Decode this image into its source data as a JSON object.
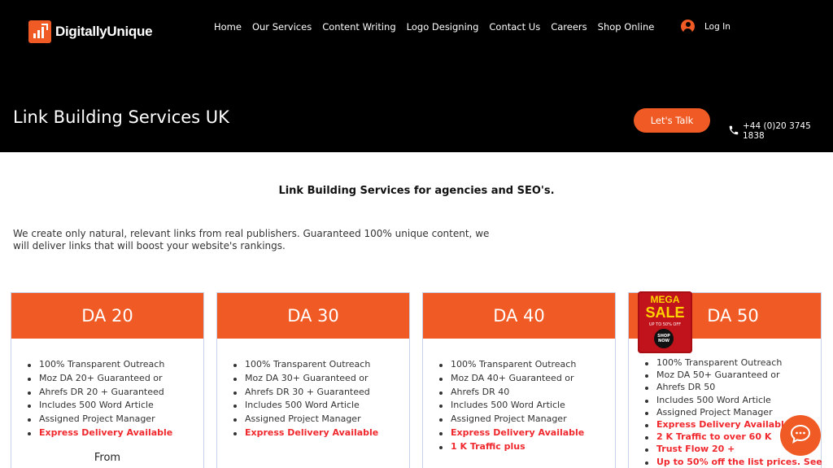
{
  "logo": {
    "text": "DigitallyUnique"
  },
  "nav": {
    "items": [
      "Home",
      "Our Services",
      "Content Writing",
      "Logo Designing",
      "Contact Us",
      "Careers",
      "Shop Online"
    ],
    "login_label": "Log In"
  },
  "hero": {
    "title": "Link Building Services UK",
    "cta_label": "Let's Talk",
    "phone": "+44 (0)20 3745 1838"
  },
  "main": {
    "subtitle": "Link Building Services for agencies and SEO's.",
    "intro": "We create only natural, relevant links from real publishers. Guaranteed 100% unique content, we will deliver links that will boost your website's rankings."
  },
  "cards": [
    {
      "title": "DA 20",
      "features": [
        "100% Transparent Outreach",
        "Moz DA 20+ Guaranteed or",
        "Ahrefs DR 20 + Guaranteed",
        "Includes 500 Word Article",
        "Assigned Project Manager"
      ],
      "highlights": [
        "Express Delivery Available"
      ],
      "footer": "From"
    },
    {
      "title": "DA 30",
      "features": [
        "100% Transparent Outreach",
        "Moz DA 30+ Guaranteed or",
        "Ahrefs DR 30 + Guaranteed",
        "Includes 500 Word Article",
        "Assigned Project Manager"
      ],
      "highlights": [
        "Express Delivery Available"
      ]
    },
    {
      "title": "DA 40",
      "features": [
        "100% Transparent Outreach",
        "Moz DA 40+ Guaranteed or",
        "Ahrefs DR 40",
        "Includes 500 Word Article",
        "Assigned Project Manager"
      ],
      "highlights": [
        "Express Delivery Available",
        "1 K Traffic plus"
      ]
    },
    {
      "title": "DA 50",
      "features": [
        "100% Transparent Outreach",
        "Moz DA 50+ Guaranteed or",
        "Ahrefs DR 50",
        "Includes 500 Word Article",
        "Assigned Project Manager"
      ],
      "highlights": [
        "Express Delivery Available",
        "2 K Traffic to over 60 K",
        "Trust Flow 20 +",
        "Up to 50% off the list prices. See"
      ]
    }
  ],
  "sale_badge": {
    "line1": "MEGA",
    "line2": "SALE",
    "line3": "UP TO 50% OFF",
    "button": "SHOP NOW"
  },
  "icons": {
    "login": "user-circle-icon",
    "phone": "phone-icon",
    "chat": "chat-bubble-icon"
  },
  "colors": {
    "accent": "#f05a24",
    "highlight_text": "#f0292e",
    "header_bg": "#000000"
  }
}
